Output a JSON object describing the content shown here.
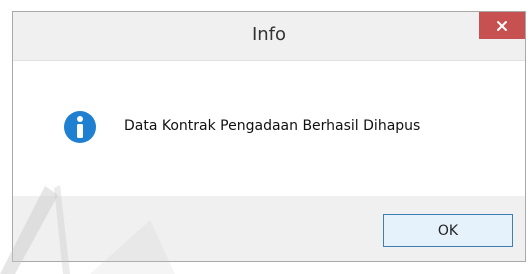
{
  "dialog": {
    "title": "Info",
    "message": "Data Kontrak Pengadaan Berhasil Dihapus",
    "ok_label": "OK",
    "close_icon": "close-icon",
    "info_icon": "information-icon"
  },
  "colors": {
    "close_button": "#c75050",
    "info_icon": "#1f7fd1",
    "ok_border": "#3c7fb1",
    "ok_fill": "#e5f1fb",
    "titlebar": "#f0f0f0",
    "footer": "#f0f0f0"
  }
}
